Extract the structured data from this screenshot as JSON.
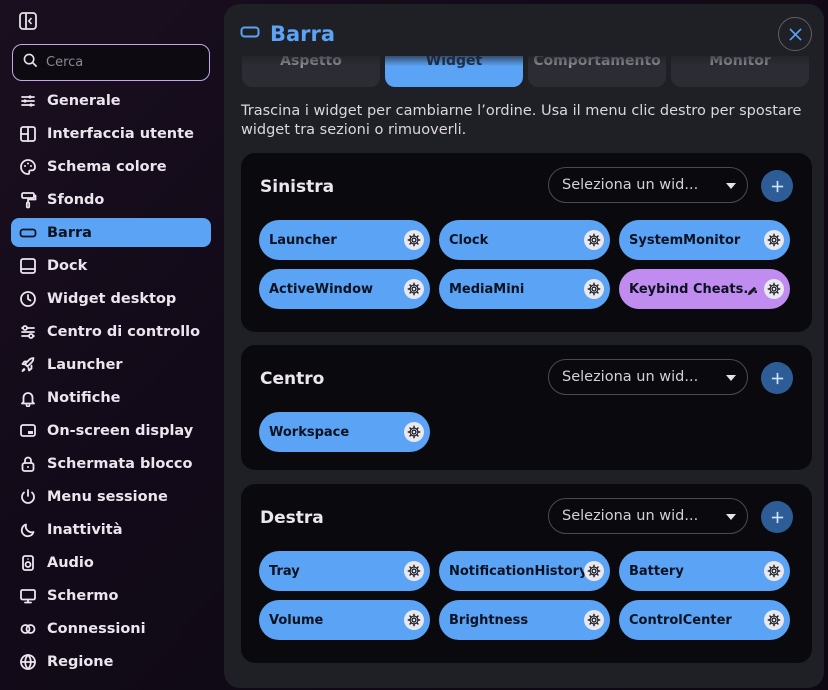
{
  "sidebar": {
    "search_placeholder": "Cerca",
    "items": [
      {
        "label": "Generale",
        "icon": "sliders-icon"
      },
      {
        "label": "Interfaccia utente",
        "icon": "layout-icon"
      },
      {
        "label": "Schema colore",
        "icon": "palette-icon"
      },
      {
        "label": "Sfondo",
        "icon": "paint-roller-icon"
      },
      {
        "label": "Barra",
        "icon": "bar-icon",
        "active": true
      },
      {
        "label": "Dock",
        "icon": "dock-icon"
      },
      {
        "label": "Widget desktop",
        "icon": "clock-icon"
      },
      {
        "label": "Centro di controllo",
        "icon": "control-center-icon"
      },
      {
        "label": "Launcher",
        "icon": "rocket-icon"
      },
      {
        "label": "Notifiche",
        "icon": "bell-icon"
      },
      {
        "label": "On-screen display",
        "icon": "osd-icon"
      },
      {
        "label": "Schermata blocco",
        "icon": "lock-icon"
      },
      {
        "label": "Menu sessione",
        "icon": "power-icon"
      },
      {
        "label": "Inattività",
        "icon": "moon-icon"
      },
      {
        "label": "Audio",
        "icon": "speaker-icon"
      },
      {
        "label": "Schermo",
        "icon": "monitor-icon"
      },
      {
        "label": "Connessioni",
        "icon": "link-icon"
      },
      {
        "label": "Regione",
        "icon": "globe-icon"
      }
    ]
  },
  "panel": {
    "title": "Barra",
    "tabs": [
      "Aspetto",
      "Widget",
      "Comportamento",
      "Monitor"
    ],
    "active_tab": "Widget",
    "description": "Trascina i widget per cambiarne l’ordine. Usa il menu clic destro per spostare widget tra sezioni o rimuoverli.",
    "sections": [
      {
        "title": "Sinistra",
        "select_placeholder": "Seleziona un wid...",
        "widgets": [
          {
            "label": "Launcher"
          },
          {
            "label": "Clock"
          },
          {
            "label": "SystemMonitor"
          },
          {
            "label": "ActiveWindow"
          },
          {
            "label": "MediaMini"
          },
          {
            "label": "Keybind Cheats...",
            "purple": true
          }
        ]
      },
      {
        "title": "Centro",
        "select_placeholder": "Seleziona un wid...",
        "widgets": [
          {
            "label": "Workspace"
          }
        ]
      },
      {
        "title": "Destra",
        "select_placeholder": "Seleziona un wid...",
        "widgets": [
          {
            "label": "Tray"
          },
          {
            "label": "NotificationHistory"
          },
          {
            "label": "Battery"
          },
          {
            "label": "Volume"
          },
          {
            "label": "Brightness"
          },
          {
            "label": "ControlCenter"
          }
        ]
      }
    ]
  },
  "colors": {
    "accent": "#5ba3f5",
    "purple_chip": "#c18cf0",
    "add_button": "#2e5c96"
  }
}
